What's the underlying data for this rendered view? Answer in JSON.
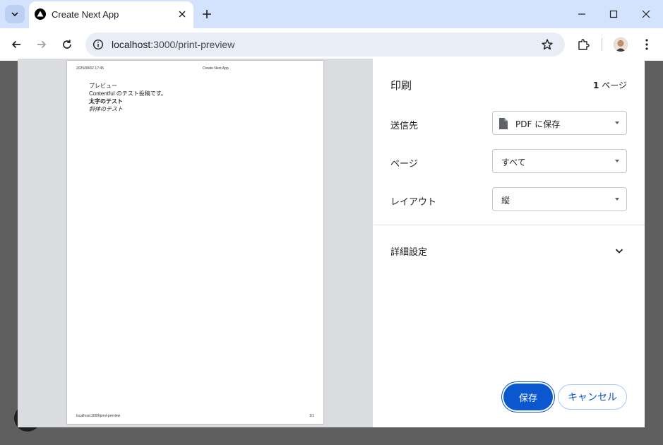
{
  "browser": {
    "tab_title": "Create Next App",
    "url_host": "localhost",
    "url_path": ":3000/print-preview"
  },
  "preview": {
    "header_date": "2025/08/02 17:45",
    "header_title": "Create Next App",
    "heading": "プレビュー",
    "line1": "Contentful のテスト投稿です。",
    "bold_line": "太字のテスト",
    "italic_line": "斜体のテスト",
    "footer_url": "localhost:3000/print-preview",
    "footer_page": "1/1"
  },
  "print_dialog": {
    "title": "印刷",
    "page_count_num": "1",
    "page_count_unit": "ページ",
    "destination_label": "送信先",
    "destination_value": "PDF に保存",
    "pages_label": "ページ",
    "pages_value": "すべて",
    "layout_label": "レイアウト",
    "layout_value": "縦",
    "advanced_label": "詳細設定",
    "save_label": "保存",
    "cancel_label": "キャンセル"
  },
  "colors": {
    "accent": "#0b57d0",
    "tabbar": "#d3e3fd"
  }
}
